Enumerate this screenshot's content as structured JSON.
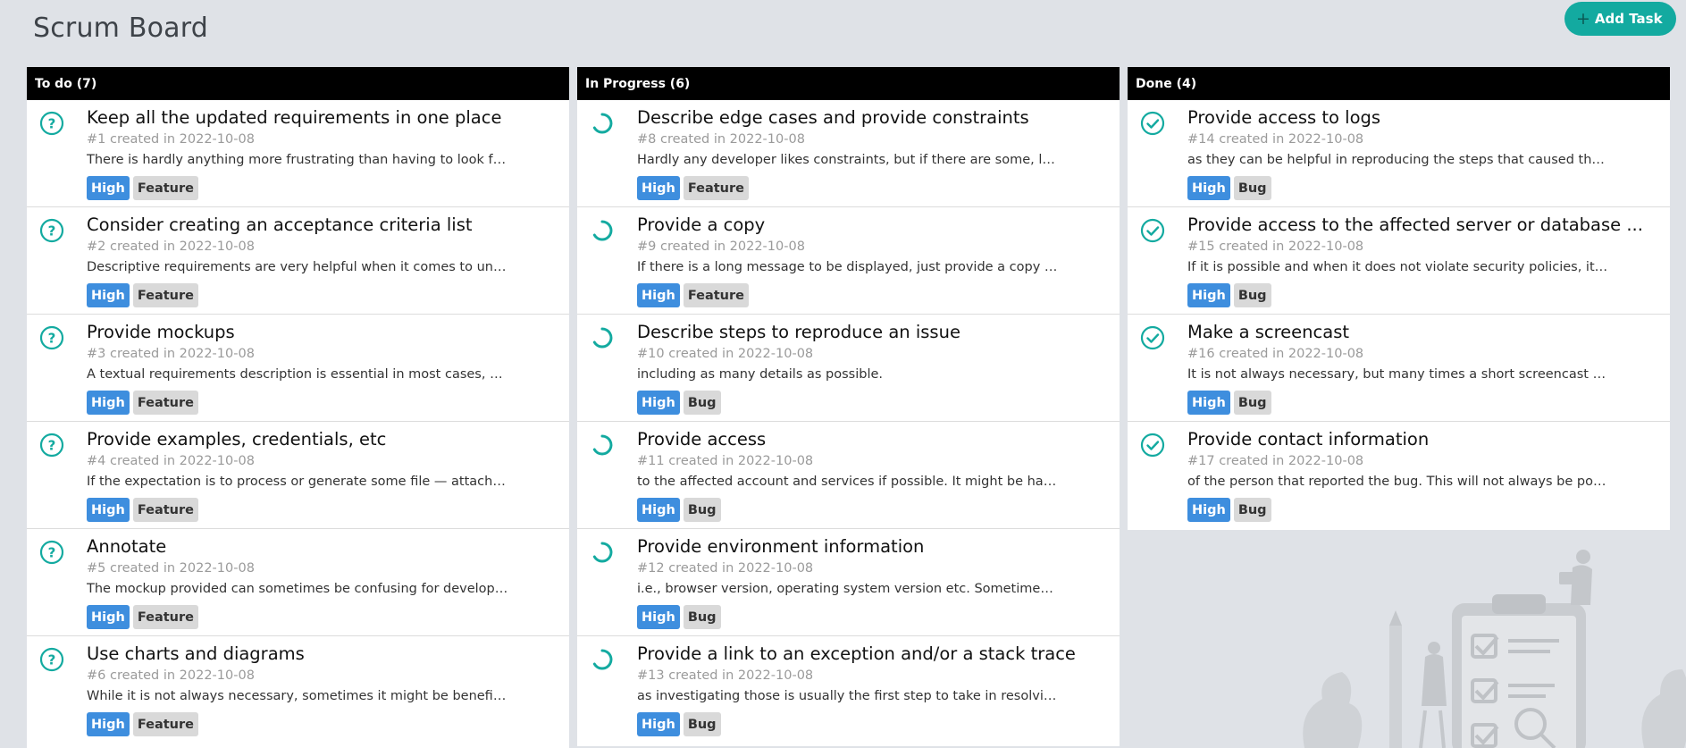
{
  "header": {
    "title": "Scrum Board",
    "add_task_label": "Add Task",
    "add_task_icon": "plus-icon"
  },
  "colors": {
    "accent": "#13aaa0",
    "priority_tag": "#3e8ede",
    "type_tag": "#d9d9d9",
    "column_header": "#000000",
    "background": "#dfe2e7"
  },
  "columns": [
    {
      "header": "To do (7)",
      "status_icon": "question-circle-icon",
      "cards": [
        {
          "title": "Keep all the updated requirements in one place",
          "meta": "#1 created in 2022-10-08",
          "desc": "There is hardly anything more frustrating than having to look for c...",
          "priority": "High",
          "type": "Feature"
        },
        {
          "title": "Consider creating an acceptance criteria list",
          "meta": "#2 created in 2022-10-08",
          "desc": "Descriptive requirements are very helpful when it comes to under...",
          "priority": "High",
          "type": "Feature"
        },
        {
          "title": "Provide mockups",
          "meta": "#3 created in 2022-10-08",
          "desc": "A textual requirements description is essential in most cases, but ...",
          "priority": "High",
          "type": "Feature"
        },
        {
          "title": "Provide examples, credentials, etc",
          "meta": "#4 created in 2022-10-08",
          "desc": "If the expectation is to process or generate some file — attach an ...",
          "priority": "High",
          "type": "Feature"
        },
        {
          "title": "Annotate",
          "meta": "#5 created in 2022-10-08",
          "desc": "The mockup provided can sometimes be confusing for developers...",
          "priority": "High",
          "type": "Feature"
        },
        {
          "title": "Use charts and diagrams",
          "meta": "#6 created in 2022-10-08",
          "desc": "While it is not always necessary, sometimes it might be beneficial ...",
          "priority": "High",
          "type": "Feature"
        }
      ]
    },
    {
      "header": "In Progress (6)",
      "status_icon": "progress-spinner-icon",
      "cards": [
        {
          "title": "Describe edge cases and provide constraints",
          "meta": "#8 created in 2022-10-08",
          "desc": "Hardly any developer likes constraints, but if there are some, let t...",
          "priority": "High",
          "type": "Feature"
        },
        {
          "title": "Provide a copy",
          "meta": "#9 created in 2022-10-08",
          "desc": "If there is a long message to be displayed, just provide a copy for i...",
          "priority": "High",
          "type": "Feature"
        },
        {
          "title": "Describe steps to reproduce an issue",
          "meta": "#10 created in 2022-10-08",
          "desc": "including as many details as possible.",
          "priority": "High",
          "type": "Bug"
        },
        {
          "title": "Provide access",
          "meta": "#11 created in 2022-10-08",
          "desc": "to the affected account and services if possible. It might be hard t...",
          "priority": "High",
          "type": "Bug"
        },
        {
          "title": "Provide environment information",
          "meta": "#12 created in 2022-10-08",
          "desc": "i.e., browser version, operating system version etc. Sometimes a li...",
          "priority": "High",
          "type": "Bug"
        },
        {
          "title": "Provide a link to an exception and/or a stack trace",
          "meta": "#13 created in 2022-10-08",
          "desc": "as investigating those is usually the first step to take in resolving t...",
          "priority": "High",
          "type": "Bug"
        }
      ]
    },
    {
      "header": "Done (4)",
      "status_icon": "check-circle-icon",
      "cards": [
        {
          "title": "Provide access to logs",
          "meta": "#14 created in 2022-10-08",
          "desc": "as they can be helpful in reproducing the steps that caused the pr...",
          "priority": "High",
          "type": "Bug"
        },
        {
          "title": "Provide access to the affected server or database ...",
          "meta": "#15 created in 2022-10-08",
          "desc": "If it is possible and when it does not violate security policies, it is u...",
          "priority": "High",
          "type": "Bug"
        },
        {
          "title": "Make a screencast",
          "meta": "#16 created in 2022-10-08",
          "desc": "It is not always necessary, but many times a short screencast (or a...",
          "priority": "High",
          "type": "Bug"
        },
        {
          "title": "Provide contact information",
          "meta": "#17 created in 2022-10-08",
          "desc": "of the person that reported the bug. This will not always be possib...",
          "priority": "High",
          "type": "Bug"
        }
      ]
    }
  ]
}
